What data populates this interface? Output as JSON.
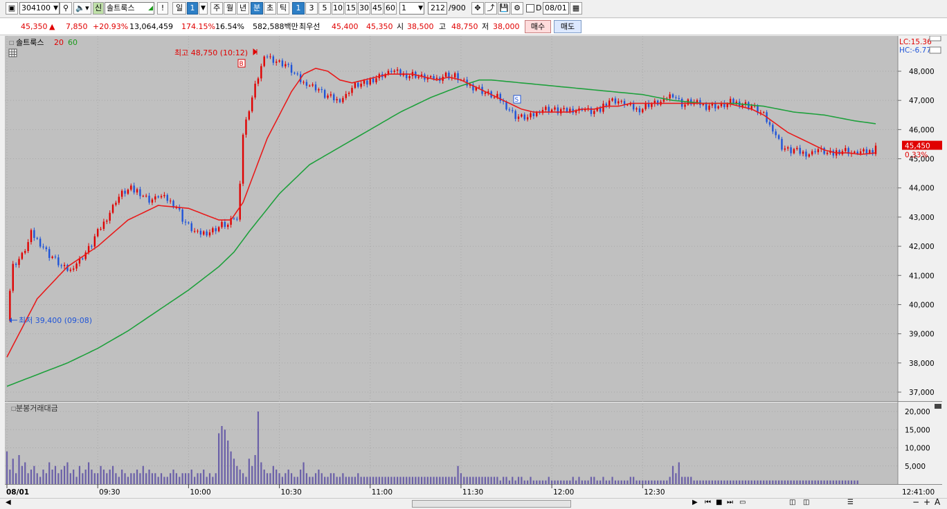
{
  "toolbar": {
    "code": "304100",
    "stock_name": "솔트룩스",
    "stock_badge": "신",
    "alert": "!",
    "day": "일",
    "day_count": "1",
    "week": "주",
    "month": "월",
    "year": "년",
    "minute": "분",
    "second": "초",
    "tick": "틱",
    "intervals": [
      "1",
      "3",
      "5",
      "10",
      "15",
      "30",
      "45",
      "60"
    ],
    "custom_interval": "1",
    "count": "212",
    "count_max": "/900",
    "date_check_label": "D",
    "date": "08/01"
  },
  "quote": {
    "price": "45,350",
    "change": "7,850",
    "change_pct": "+20.93%",
    "volume": "13,064,459",
    "volume_ratio": "174.15%",
    "turnover": "16.54%",
    "amount": "582,588백만",
    "best_label": "최우선",
    "best_ask": "45,400",
    "best_bid": "45,350",
    "open_label": "시",
    "open": "38,500",
    "high_label": "고",
    "high": "48,750",
    "low_label": "저",
    "low": "38,000",
    "buy": "매수",
    "sell": "매도"
  },
  "chart_data": {
    "type": "candlestick",
    "title": "솔트룩스",
    "ma_labels": [
      "20",
      "60"
    ],
    "lc": "LC:15.36",
    "hc": "HC:-6.77",
    "price_ticks": [
      "48,000",
      "47,000",
      "46,000",
      "45,000",
      "44,000",
      "43,000",
      "42,000",
      "41,000",
      "40,000",
      "39,000",
      "38,000",
      "37,000"
    ],
    "current_price": "45,450",
    "current_pct": "0.33%",
    "high_marker": "최고 48,750 (10:12)",
    "low_marker": "최저 39,400 (09:08)",
    "buy_marker": "B",
    "sell_marker": "S",
    "volume_title": "분봉거래대금",
    "volume_ticks": [
      "20,000",
      "15,000",
      "10,000",
      "5,000"
    ],
    "time_ticks": [
      "08/01",
      "09:30",
      "10:00",
      "10:30",
      "11:00",
      "11:30",
      "12:00",
      "12:30"
    ],
    "last_time": "12:41:00",
    "ylim": [
      36800,
      49000
    ],
    "close_path": [
      [
        0,
        39600
      ],
      [
        2,
        41300
      ],
      [
        5,
        41700
      ],
      [
        8,
        42400
      ],
      [
        12,
        42000
      ],
      [
        15,
        41600
      ],
      [
        18,
        41300
      ],
      [
        21,
        41200
      ],
      [
        24,
        41500
      ],
      [
        28,
        42100
      ],
      [
        32,
        42800
      ],
      [
        35,
        43400
      ],
      [
        38,
        43800
      ],
      [
        41,
        44000
      ],
      [
        44,
        43800
      ],
      [
        47,
        43600
      ],
      [
        50,
        43700
      ],
      [
        53,
        43600
      ],
      [
        56,
        43400
      ],
      [
        58,
        42900
      ],
      [
        61,
        42600
      ],
      [
        64,
        42400
      ],
      [
        67,
        42500
      ],
      [
        70,
        42700
      ],
      [
        73,
        42700
      ],
      [
        75,
        43000
      ],
      [
        76,
        42900
      ],
      [
        77,
        44300
      ],
      [
        78,
        45800
      ],
      [
        80,
        46700
      ],
      [
        82,
        47500
      ],
      [
        84,
        48200
      ],
      [
        86,
        48500
      ],
      [
        88,
        48400
      ],
      [
        91,
        48300
      ],
      [
        94,
        48000
      ],
      [
        97,
        47700
      ],
      [
        100,
        47500
      ],
      [
        103,
        47400
      ],
      [
        106,
        47100
      ],
      [
        109,
        47000
      ],
      [
        112,
        47200
      ],
      [
        115,
        47500
      ],
      [
        118,
        47600
      ],
      [
        121,
        47700
      ],
      [
        124,
        47900
      ],
      [
        127,
        48000
      ],
      [
        130,
        47900
      ],
      [
        133,
        47900
      ],
      [
        136,
        47800
      ],
      [
        139,
        47800
      ],
      [
        142,
        47700
      ],
      [
        145,
        47900
      ],
      [
        148,
        47800
      ],
      [
        151,
        47600
      ],
      [
        154,
        47500
      ],
      [
        157,
        47300
      ],
      [
        160,
        47200
      ],
      [
        163,
        47000
      ],
      [
        166,
        46700
      ],
      [
        169,
        46400
      ],
      [
        172,
        46400
      ],
      [
        175,
        46600
      ],
      [
        178,
        46700
      ],
      [
        181,
        46700
      ],
      [
        184,
        46600
      ],
      [
        187,
        46700
      ],
      [
        190,
        46700
      ],
      [
        193,
        46600
      ],
      [
        196,
        46700
      ],
      [
        199,
        47000
      ],
      [
        202,
        47000
      ],
      [
        205,
        46800
      ],
      [
        208,
        46700
      ],
      [
        211,
        46800
      ],
      [
        214,
        46900
      ],
      [
        217,
        47000
      ],
      [
        220,
        47200
      ],
      [
        223,
        46900
      ],
      [
        226,
        46900
      ],
      [
        229,
        46900
      ],
      [
        232,
        46800
      ],
      [
        235,
        46800
      ],
      [
        238,
        46900
      ],
      [
        241,
        46900
      ],
      [
        244,
        46900
      ],
      [
        247,
        46700
      ],
      [
        250,
        46500
      ],
      [
        253,
        46000
      ],
      [
        256,
        45400
      ],
      [
        259,
        45300
      ],
      [
        262,
        45200
      ],
      [
        265,
        45200
      ],
      [
        268,
        45300
      ],
      [
        271,
        45200
      ],
      [
        274,
        45200
      ],
      [
        277,
        45300
      ],
      [
        280,
        45200
      ],
      [
        283,
        45200
      ],
      [
        286,
        45300
      ],
      [
        287,
        45450
      ]
    ],
    "ma20": [
      [
        0,
        38200
      ],
      [
        10,
        40200
      ],
      [
        20,
        41300
      ],
      [
        30,
        42000
      ],
      [
        40,
        42900
      ],
      [
        50,
        43400
      ],
      [
        60,
        43300
      ],
      [
        70,
        42900
      ],
      [
        74,
        42900
      ],
      [
        78,
        43500
      ],
      [
        82,
        44600
      ],
      [
        86,
        45700
      ],
      [
        90,
        46500
      ],
      [
        94,
        47300
      ],
      [
        98,
        47900
      ],
      [
        102,
        48100
      ],
      [
        106,
        48000
      ],
      [
        110,
        47700
      ],
      [
        114,
        47600
      ],
      [
        118,
        47700
      ],
      [
        122,
        47800
      ],
      [
        126,
        47900
      ],
      [
        130,
        47900
      ],
      [
        134,
        47900
      ],
      [
        138,
        47800
      ],
      [
        142,
        47700
      ],
      [
        146,
        47800
      ],
      [
        150,
        47700
      ],
      [
        154,
        47500
      ],
      [
        158,
        47300
      ],
      [
        162,
        47100
      ],
      [
        166,
        46900
      ],
      [
        170,
        46700
      ],
      [
        174,
        46600
      ],
      [
        178,
        46600
      ],
      [
        182,
        46600
      ],
      [
        186,
        46600
      ],
      [
        190,
        46700
      ],
      [
        194,
        46700
      ],
      [
        198,
        46800
      ],
      [
        202,
        46800
      ],
      [
        206,
        46900
      ],
      [
        210,
        46900
      ],
      [
        214,
        46900
      ],
      [
        218,
        46900
      ],
      [
        222,
        46900
      ],
      [
        226,
        46900
      ],
      [
        230,
        46900
      ],
      [
        234,
        46900
      ],
      [
        238,
        46900
      ],
      [
        242,
        46800
      ],
      [
        246,
        46700
      ],
      [
        250,
        46500
      ],
      [
        254,
        46200
      ],
      [
        258,
        45900
      ],
      [
        262,
        45700
      ],
      [
        266,
        45500
      ],
      [
        270,
        45300
      ],
      [
        274,
        45200
      ],
      [
        278,
        45200
      ],
      [
        282,
        45150
      ],
      [
        287,
        45200
      ]
    ],
    "ma60": [
      [
        0,
        37200
      ],
      [
        10,
        37600
      ],
      [
        20,
        38000
      ],
      [
        30,
        38500
      ],
      [
        40,
        39100
      ],
      [
        50,
        39800
      ],
      [
        60,
        40500
      ],
      [
        70,
        41300
      ],
      [
        75,
        41800
      ],
      [
        80,
        42500
      ],
      [
        90,
        43800
      ],
      [
        100,
        44800
      ],
      [
        110,
        45400
      ],
      [
        120,
        46000
      ],
      [
        130,
        46600
      ],
      [
        140,
        47100
      ],
      [
        150,
        47500
      ],
      [
        156,
        47700
      ],
      [
        160,
        47700
      ],
      [
        170,
        47600
      ],
      [
        180,
        47500
      ],
      [
        190,
        47400
      ],
      [
        200,
        47300
      ],
      [
        210,
        47200
      ],
      [
        220,
        47000
      ],
      [
        230,
        46900
      ],
      [
        240,
        46900
      ],
      [
        250,
        46800
      ],
      [
        260,
        46600
      ],
      [
        270,
        46500
      ],
      [
        280,
        46300
      ],
      [
        287,
        46200
      ]
    ],
    "volume_series": [
      9,
      4,
      7,
      3,
      8,
      5,
      6,
      3,
      4,
      5,
      3,
      2,
      4,
      3,
      6,
      4,
      5,
      3,
      4,
      5,
      6,
      3,
      4,
      2,
      5,
      3,
      4,
      6,
      4,
      3,
      3,
      5,
      4,
      3,
      4,
      5,
      3,
      2,
      4,
      3,
      2,
      3,
      3,
      4,
      3,
      5,
      3,
      4,
      3,
      3,
      2,
      3,
      2,
      2,
      3,
      4,
      3,
      2,
      3,
      3,
      3,
      4,
      2,
      3,
      3,
      4,
      2,
      3,
      2,
      3,
      14,
      16,
      15,
      12,
      9,
      7,
      5,
      4,
      3,
      2,
      7,
      5,
      8,
      20,
      6,
      4,
      3,
      3,
      5,
      4,
      3,
      2,
      3,
      4,
      3,
      2,
      2,
      4,
      6,
      3,
      2,
      2,
      3,
      4,
      3,
      2,
      2,
      3,
      3,
      2,
      2,
      3,
      2,
      2,
      2,
      2,
      3,
      2,
      2,
      2,
      2,
      2,
      2,
      2,
      2,
      2,
      2,
      2,
      2,
      2,
      2,
      2,
      2,
      2,
      2,
      2,
      2,
      2,
      2,
      2,
      2,
      2,
      2,
      2,
      2,
      2,
      2,
      2,
      2,
      5,
      3,
      2,
      2,
      2,
      2,
      2,
      2,
      2,
      2,
      2,
      2,
      2,
      2,
      1,
      2,
      2,
      1,
      2,
      1,
      2,
      2,
      1,
      1,
      2,
      1,
      1,
      1,
      1,
      1,
      2,
      1,
      1,
      1,
      1,
      1,
      1,
      1,
      2,
      1,
      2,
      1,
      1,
      1,
      2,
      2,
      1,
      1,
      2,
      1,
      1,
      2,
      1,
      1,
      1,
      1,
      1,
      2,
      2,
      1,
      1,
      1,
      1,
      1,
      1,
      1,
      1,
      1,
      1,
      1,
      2,
      5,
      3,
      6,
      2,
      2,
      2,
      2,
      1,
      1,
      1,
      1,
      1,
      1,
      1,
      1,
      1,
      1,
      1,
      1,
      1,
      1,
      1,
      1,
      1,
      1,
      1,
      1,
      1,
      1,
      1,
      1,
      1,
      1,
      1,
      1,
      1,
      1,
      1,
      1,
      1,
      1,
      1,
      1,
      1,
      1,
      1,
      1,
      1,
      1,
      1,
      1,
      1,
      1,
      1,
      1,
      1,
      1,
      1,
      1,
      1,
      1,
      1
    ]
  },
  "colors": {
    "up": "#e00000",
    "down": "#1f54d8",
    "ma20": "#e81b1b",
    "ma60": "#1ea03c",
    "volume": "#6a5fa8",
    "chart_bg": "#c0c0c0"
  }
}
